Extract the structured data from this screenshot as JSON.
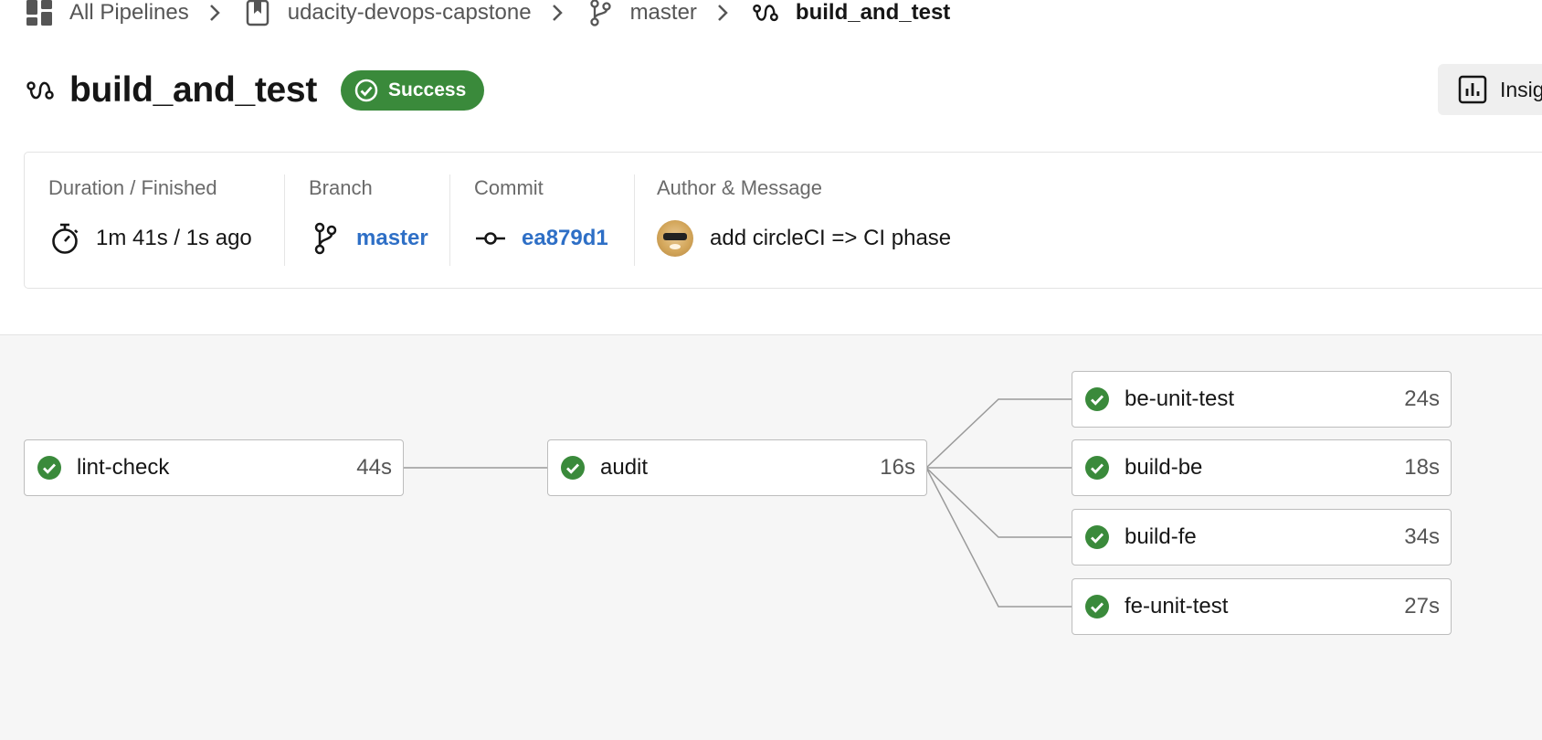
{
  "breadcrumb": {
    "items": [
      {
        "label": "All Pipelines",
        "icon": "dashboard-icon"
      },
      {
        "label": "udacity-devops-capstone",
        "icon": "repo-bookmark-icon"
      },
      {
        "label": "master",
        "icon": "git-branch-icon"
      },
      {
        "label": "build_and_test",
        "icon": "workflow-icon"
      }
    ]
  },
  "header": {
    "title": "build_and_test",
    "status": "Success",
    "insights_label": "Insig"
  },
  "summary": {
    "duration": {
      "label": "Duration / Finished",
      "value": "1m 41s / 1s ago"
    },
    "branch": {
      "label": "Branch",
      "value": "master"
    },
    "commit": {
      "label": "Commit",
      "value": "ea879d1"
    },
    "author": {
      "label": "Author & Message",
      "message": "add circleCI => CI phase"
    }
  },
  "jobs": [
    {
      "name": "lint-check",
      "duration": "44s",
      "status": "success"
    },
    {
      "name": "audit",
      "duration": "16s",
      "status": "success"
    },
    {
      "name": "be-unit-test",
      "duration": "24s",
      "status": "success"
    },
    {
      "name": "build-be",
      "duration": "18s",
      "status": "success"
    },
    {
      "name": "build-fe",
      "duration": "34s",
      "status": "success"
    },
    {
      "name": "fe-unit-test",
      "duration": "27s",
      "status": "success"
    }
  ],
  "colors": {
    "success": "#3a8a3b",
    "link": "#2e6fc6",
    "workflow_bg": "#f6f6f6"
  }
}
